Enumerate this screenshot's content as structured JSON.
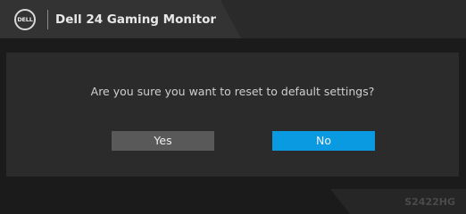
{
  "header": {
    "logo_text": "DELL",
    "title": "Dell 24 Gaming Monitor"
  },
  "dialog": {
    "prompt": "Are you sure you want to reset to default settings?",
    "yes_label": "Yes",
    "no_label": "No",
    "selected_button": "No"
  },
  "footer": {
    "model": "S2422HG"
  },
  "colors": {
    "background": "#1b1b1b",
    "header_tab": "#333333",
    "dialog_panel": "#2b2b2b",
    "button_idle": "#595959",
    "button_selected": "#0a9ae2"
  }
}
